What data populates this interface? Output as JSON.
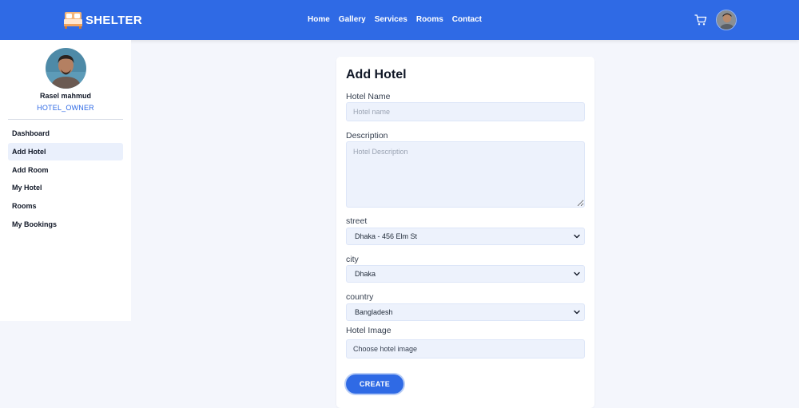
{
  "navbar": {
    "brand": "SHELTER",
    "links": [
      "Home",
      "Gallery",
      "Services",
      "Rooms",
      "Contact"
    ],
    "cart_icon": "cart-icon",
    "accent": "#2f6ae5"
  },
  "sidebar": {
    "user_name": "Rasel mahmud",
    "user_role": "HOTEL_OWNER",
    "items": [
      {
        "label": "Dashboard"
      },
      {
        "label": "Add Hotel"
      },
      {
        "label": "Add Room"
      },
      {
        "label": "My Hotel"
      },
      {
        "label": "Rooms"
      },
      {
        "label": "My Bookings"
      }
    ],
    "active_item": "Add Hotel"
  },
  "form": {
    "title": "Add Hotel",
    "hotel_name": {
      "label": "Hotel Name",
      "placeholder": "Hotel name",
      "value": ""
    },
    "description": {
      "label": "Description",
      "placeholder": "Hotel Description",
      "value": ""
    },
    "street": {
      "label": "street",
      "selected": "Dhaka - 456 Elm St"
    },
    "city": {
      "label": "city",
      "selected": "Dhaka"
    },
    "country": {
      "label": "country",
      "selected": "Bangladesh"
    },
    "image": {
      "label": "Hotel Image",
      "placeholder": "Choose hotel image"
    },
    "submit_label": "CREATE"
  }
}
